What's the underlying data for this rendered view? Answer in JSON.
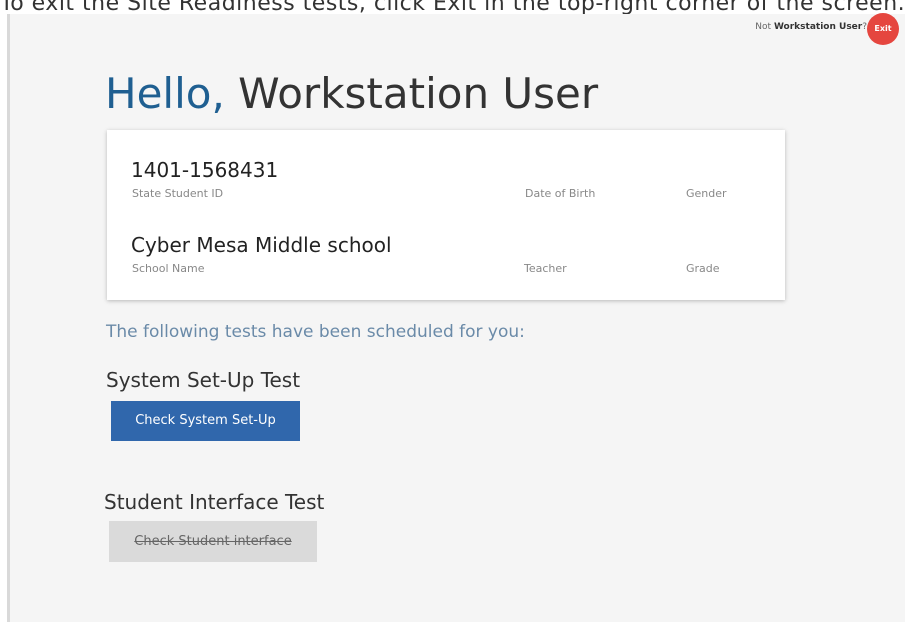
{
  "instruction": "To exit the Site Readiness tests, click Exit in the top-right corner of the screen.",
  "header": {
    "not_user_prefix": "Not",
    "not_user_name": "Workstation User",
    "not_user_suffix": "?",
    "exit_label": "Exit"
  },
  "greeting": {
    "hello": "Hello,",
    "name": "Workstation User"
  },
  "student_card": {
    "student_id": "1401-1568431",
    "student_id_label": "State Student ID",
    "dob_label": "Date of Birth",
    "gender_label": "Gender",
    "school_name": "Cyber Mesa Middle school",
    "school_name_label": "School Name",
    "teacher_label": "Teacher",
    "grade_label": "Grade"
  },
  "tests": {
    "intro": "The following tests have been scheduled for you:",
    "system_test_title": "System Set-Up Test",
    "system_test_button": "Check System Set-Up",
    "interface_test_title": "Student Interface Test",
    "interface_test_button": "Check Student interface"
  },
  "colors": {
    "accent": "#1f5f91",
    "primary_button": "#3067ac",
    "exit_button": "#e5463f"
  }
}
